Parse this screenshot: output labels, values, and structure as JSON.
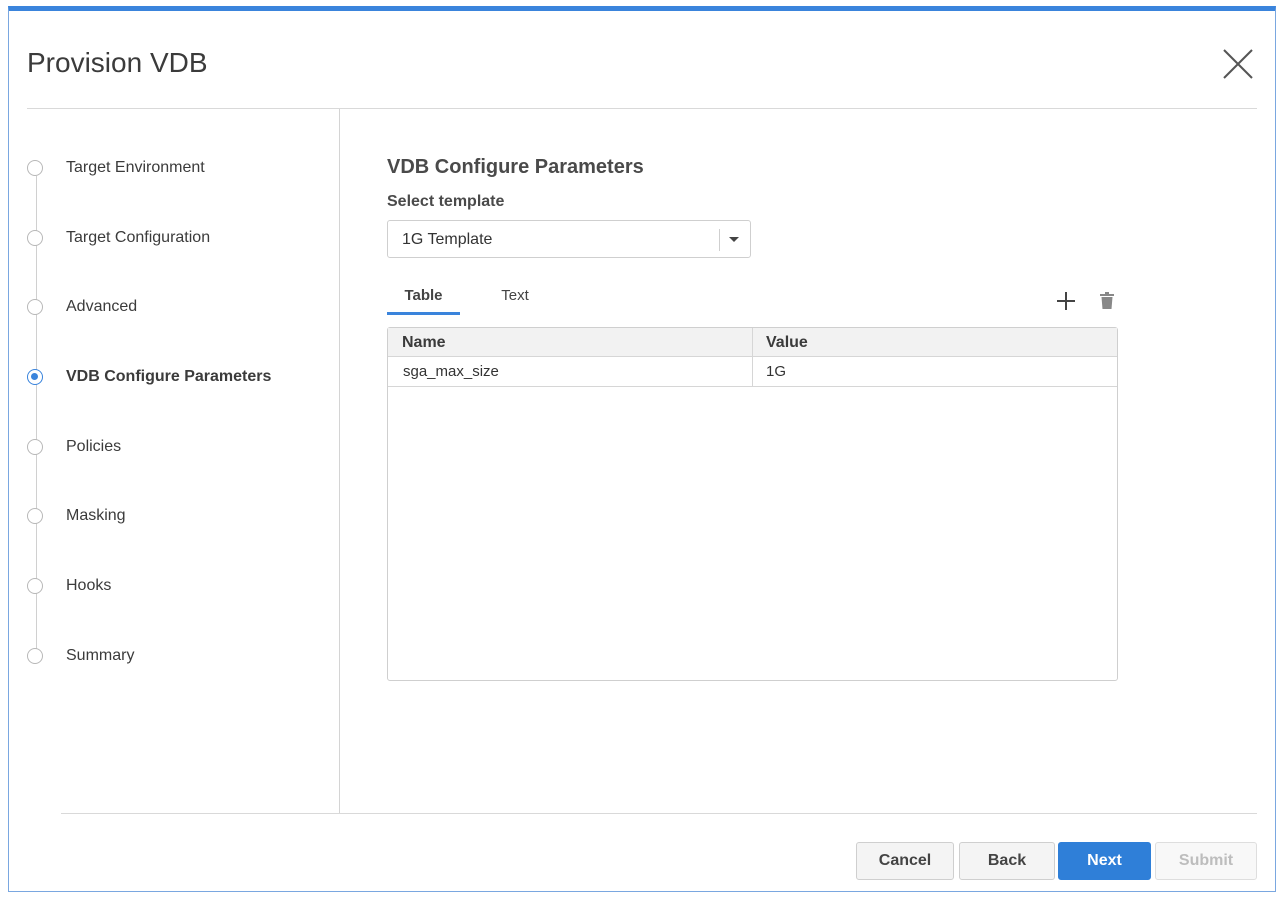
{
  "dialog": {
    "title": "Provision VDB"
  },
  "steps": [
    {
      "label": "Target Environment",
      "active": false
    },
    {
      "label": "Target Configuration",
      "active": false
    },
    {
      "label": "Advanced",
      "active": false
    },
    {
      "label": "VDB Configure Parameters",
      "active": true
    },
    {
      "label": "Policies",
      "active": false
    },
    {
      "label": "Masking",
      "active": false
    },
    {
      "label": "Hooks",
      "active": false
    },
    {
      "label": "Summary",
      "active": false
    }
  ],
  "main": {
    "title": "VDB Configure Parameters",
    "template_label": "Select template",
    "template_value": "1G Template",
    "tabs": [
      {
        "label": "Table",
        "active": true
      },
      {
        "label": "Text",
        "active": false
      }
    ],
    "table": {
      "columns": [
        "Name",
        "Value"
      ],
      "rows": [
        {
          "name": "sga_max_size",
          "value": "1G"
        }
      ]
    }
  },
  "footer": {
    "cancel": "Cancel",
    "back": "Back",
    "next": "Next",
    "submit": "Submit"
  },
  "colors": {
    "accent": "#3a84dc",
    "primary_button": "#2f7fd8"
  }
}
